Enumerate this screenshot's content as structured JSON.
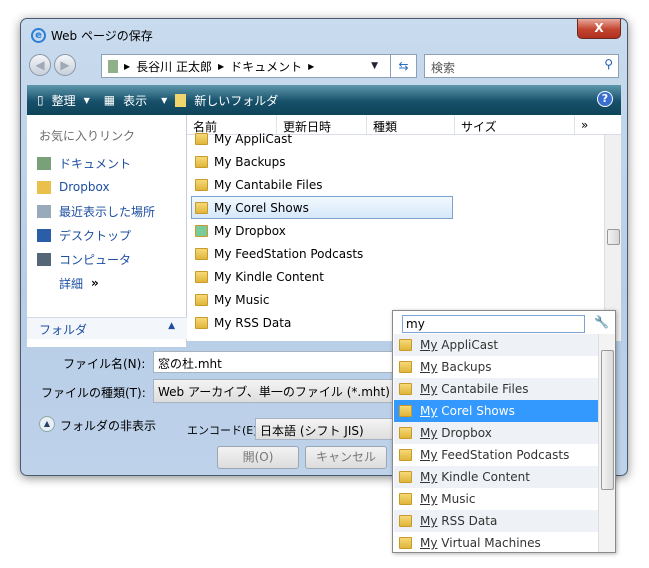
{
  "window": {
    "title": "Web ページの保存",
    "close": "X"
  },
  "address": {
    "crumbs": [
      "長谷川 正太郎",
      "ドキュメント"
    ],
    "search_placeholder": "検索"
  },
  "toolbar": {
    "organize": "整理",
    "views": "表示",
    "new_folder": "新しいフォルダ",
    "help": "?"
  },
  "sidebar": {
    "header": "お気に入りリンク",
    "items": [
      {
        "label": "ドキュメント"
      },
      {
        "label": "Dropbox"
      },
      {
        "label": "最近表示した場所"
      },
      {
        "label": "デスクトップ"
      },
      {
        "label": "コンピュータ"
      }
    ],
    "more": "詳細",
    "more_chev": "»",
    "folders": "フォルダ"
  },
  "columns": [
    "名前",
    "更新日時",
    "種類",
    "サイズ"
  ],
  "columns_more": "»",
  "files": [
    "My AppliCast",
    "My Backups",
    "My Cantabile Files",
    "My Corel Shows",
    "My Dropbox",
    "My FeedStation Podcasts",
    "My Kindle Content",
    "My Music",
    "My RSS Data"
  ],
  "form": {
    "filename_label": "ファイル名(N):",
    "filename": "窓の杜.mht",
    "type_label": "ファイルの種類(T):",
    "type": "Web アーカイブ、単一のファイル (*.mht)",
    "hide_folders": "フォルダの非表示",
    "encode_label": "エンコード(E):",
    "encode": "日本語 (シフト JIS)",
    "open": "開(O)",
    "cancel": "キャンセル"
  },
  "autocomplete": {
    "query": "my",
    "prefix": "My",
    "items": [
      " AppliCast",
      " Backups",
      " Cantabile Files",
      " Corel Shows",
      " Dropbox",
      " FeedStation Podcasts",
      " Kindle Content",
      " Music",
      " RSS Data",
      " Virtual Machines"
    ]
  }
}
